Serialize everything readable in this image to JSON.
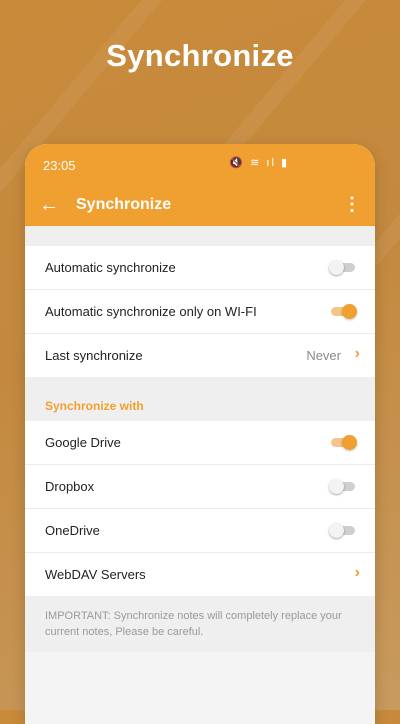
{
  "hero": {
    "title": "Synchronize"
  },
  "status_bar": {
    "time": "23:05",
    "icons": "🔇 ≋ ıl ▮"
  },
  "toolbar": {
    "title": "Synchronize"
  },
  "settings": {
    "auto_sync": {
      "label": "Automatic synchronize",
      "enabled": false
    },
    "auto_sync_wifi": {
      "label": "Automatic synchronize only on WI-FI",
      "enabled": true
    },
    "last_sync": {
      "label": "Last synchronize",
      "value": "Never"
    }
  },
  "sync_with": {
    "header": "Synchronize with",
    "google_drive": {
      "label": "Google Drive",
      "enabled": true
    },
    "dropbox": {
      "label": "Dropbox",
      "enabled": false
    },
    "onedrive": {
      "label": "OneDrive",
      "enabled": false
    },
    "webdav": {
      "label": "WebDAV Servers"
    }
  },
  "note": "IMPORTANT: Synchronize notes will completely replace your current notes, Please be careful.",
  "colors": {
    "accent": "#f0a030",
    "background": "#c98b3a"
  },
  "icons": {
    "back": "arrow-left-icon",
    "menu": "more-vertical-icon",
    "chevron": "chevron-right-icon"
  }
}
